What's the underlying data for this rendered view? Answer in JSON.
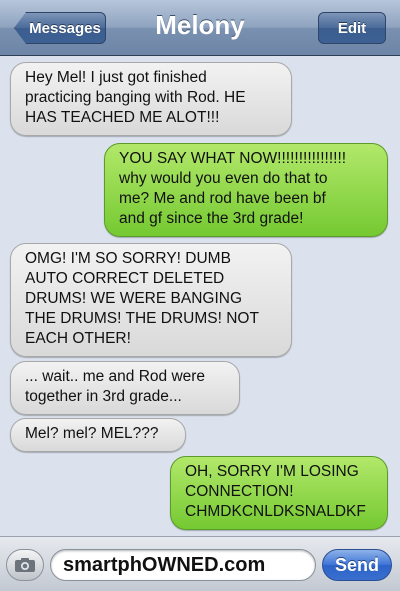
{
  "nav": {
    "back_label": "Messages",
    "title": "Melony",
    "edit_label": "Edit"
  },
  "messages": [
    {
      "sender": "them",
      "text": "Hey Mel! I just got finished\npracticing banging with Rod. HE\nHAS TEACHED  ME ALOT!!!"
    },
    {
      "sender": "me",
      "text": "YOU SAY WHAT NOW!!!!!!!!!!!!!!!!\nwhy would you even do that to\nme? Me and rod have been bf\nand gf since the 3rd grade!"
    },
    {
      "sender": "them",
      "text": "OMG! I'M SO SORRY! DUMB\nAUTO CORRECT DELETED\nDRUMS! WE WERE BANGING\nTHE DRUMS! THE DRUMS! NOT\nEACH OTHER!"
    },
    {
      "sender": "them",
      "text": "... wait.. me and Rod were\ntogether in 3rd grade..."
    },
    {
      "sender": "them",
      "text": "Mel? mel? MEL???"
    },
    {
      "sender": "me",
      "text": "OH, SORRY I'M LOSING\nCONNECTION!\nCHMDKCNLDKSNALDKF"
    }
  ],
  "composer": {
    "text_value": "smartphOWNED.com",
    "send_label": "Send",
    "camera_icon": "camera-icon"
  },
  "colors": {
    "received_bubble": "#e3e3e3",
    "sent_bubble": "#8dd64a",
    "navbar": "#7a91b0",
    "send_button": "#3d74d6"
  }
}
